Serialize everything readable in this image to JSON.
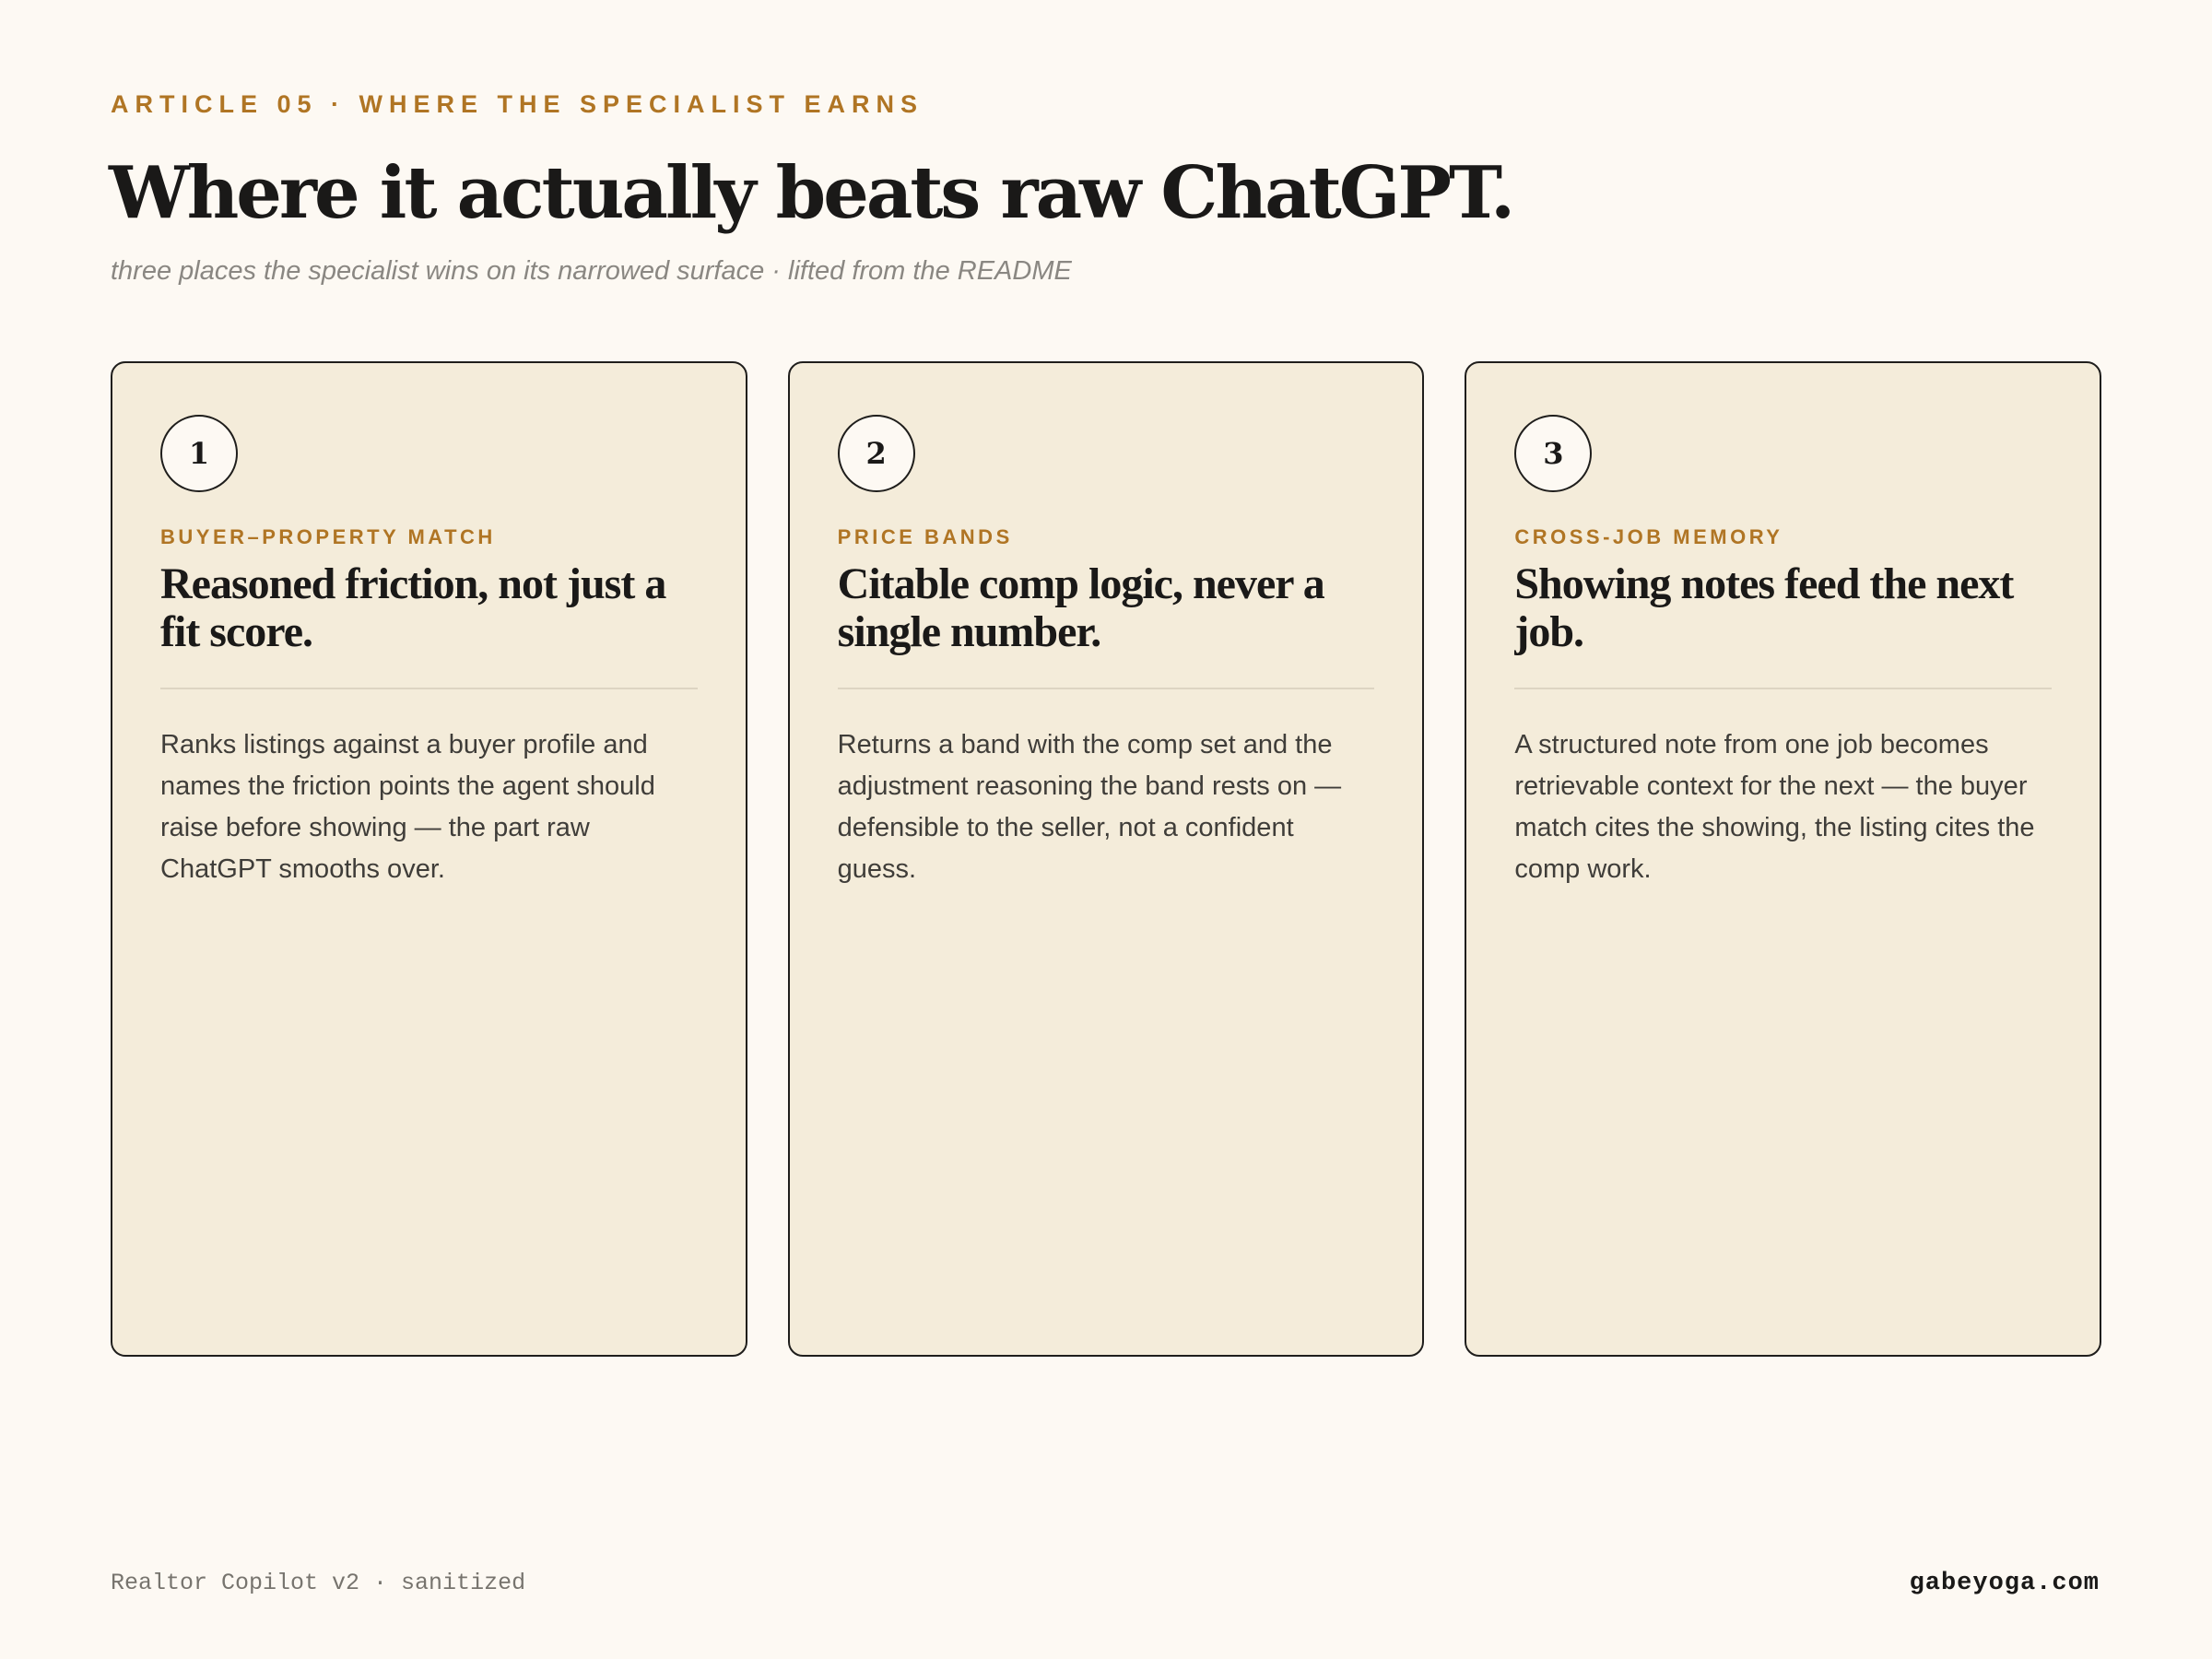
{
  "header": {
    "eyebrow": "ARTICLE 05 · WHERE THE SPECIALIST EARNS",
    "title": "Where it actually beats raw ChatGPT.",
    "subtitle": "three places the specialist wins on its narrowed surface · lifted from the README"
  },
  "cards": [
    {
      "number": "1",
      "kicker": "BUYER–PROPERTY MATCH",
      "heading": "Reasoned friction, not just a fit score.",
      "body": "Ranks listings against a buyer profile and names the friction points the agent should raise before showing — the part raw ChatGPT smooths over."
    },
    {
      "number": "2",
      "kicker": "PRICE BANDS",
      "heading": "Citable comp logic, never a single number.",
      "body": "Returns a band with the comp set and the adjustment reasoning the band rests on — defensible to the seller, not a confident guess."
    },
    {
      "number": "3",
      "kicker": "CROSS-JOB MEMORY",
      "heading": "Showing notes feed the next job.",
      "body": "A structured note from one job becomes retrievable context for the next — the buyer match cites the showing, the listing cites the comp work."
    }
  ],
  "footer": {
    "left": "Realtor Copilot v2 · sanitized",
    "right": "gabeyoga.com"
  },
  "colors": {
    "background": "#fdf9f3",
    "card_background": "#f4ecda",
    "accent": "#b07524",
    "ink": "#1a1918"
  }
}
